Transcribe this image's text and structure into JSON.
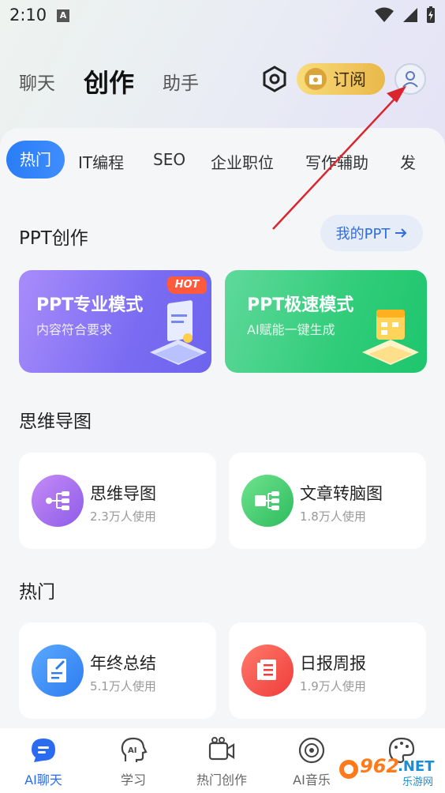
{
  "status": {
    "time": "2:10",
    "a_icon": "A"
  },
  "header": {
    "tabs": [
      {
        "label": "聊天"
      },
      {
        "label": "创作"
      },
      {
        "label": "助手"
      }
    ],
    "subscribe_label": "订阅"
  },
  "categories": [
    "热门",
    "IT编程",
    "SEO",
    "企业职位",
    "写作辅助",
    "发"
  ],
  "ppt_section": {
    "title": "PPT创作",
    "my_ppt": "我的PPT",
    "cards": [
      {
        "title": "PPT专业模式",
        "subtitle": "内容符合要求",
        "badge": "HOT"
      },
      {
        "title": "PPT极速模式",
        "subtitle": "AI赋能一键生成"
      }
    ]
  },
  "mindmap_section": {
    "title": "思维导图",
    "items": [
      {
        "name": "思维导图",
        "uses": "2.3万人使用"
      },
      {
        "name": "文章转脑图",
        "uses": "1.8万人使用"
      }
    ]
  },
  "hot_section": {
    "title": "热门",
    "items": [
      {
        "name": "年终总结",
        "uses": "5.1万人使用"
      },
      {
        "name": "日报周报",
        "uses": "1.9万人使用"
      }
    ]
  },
  "bottom_nav": [
    {
      "label": "AI聊天"
    },
    {
      "label": "学习"
    },
    {
      "label": "热门创作"
    },
    {
      "label": "AI音乐"
    },
    {
      "label": ""
    }
  ],
  "watermark": {
    "top": "962",
    "suffix": ".NET",
    "sub": "乐游网"
  },
  "colors": {
    "accent": "#2a7df5",
    "ppt_pro": "#8f6ff7",
    "ppt_fast": "#2fcc79",
    "subscribe": "#f2c55a"
  }
}
